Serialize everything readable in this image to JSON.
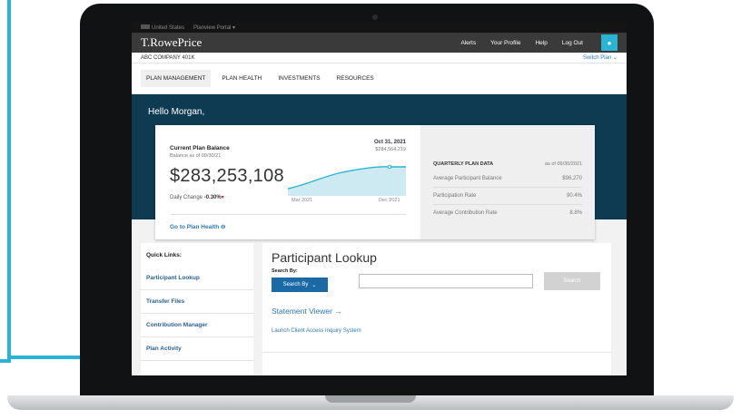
{
  "utility": {
    "country": "United States",
    "portal": "Planview Portal"
  },
  "topnav": {
    "logo": "T.RowePrice",
    "links": [
      "Alerts",
      "Your Profile",
      "Help",
      "Log Out"
    ]
  },
  "planbar": {
    "company": "ABC COMPANY 401K",
    "switch_label": "Switch Plan"
  },
  "mainnav": {
    "items": [
      "PLAN MANAGEMENT",
      "PLAN HEALTH",
      "INVESTMENTS",
      "RESOURCES"
    ]
  },
  "greeting": "Hello Morgan,",
  "balance_card": {
    "title": "Current Plan Balance",
    "as_of": "Balance as of 09/30/21",
    "amount": "$283,253,108",
    "daily_label": "Daily Change",
    "daily_value": "-0.30%",
    "spark_date": "Oct 31, 2021",
    "spark_value": "$284,564,219",
    "spark_start": "Mar 2021",
    "spark_end": "Dec 2021",
    "goto_link": "Go to Plan Health"
  },
  "quarterly": {
    "title": "QUARTERLY PLAN DATA",
    "as_of": "as of 09/30/2021",
    "rows": [
      {
        "label": "Average Participant Balance",
        "value": "$96,270"
      },
      {
        "label": "Participation Rate",
        "value": "90.4%"
      },
      {
        "label": "Average Contribution Rate",
        "value": "8.8%"
      }
    ]
  },
  "sidebar": {
    "heading": "Quick Links:",
    "links": [
      "Participant Lookup",
      "Transfer Files",
      "Contribution Manager",
      "Plan Activity"
    ]
  },
  "lookup": {
    "title": "Participant Lookup",
    "search_by_label": "Search By:",
    "select_label": "Search By",
    "search_value": "",
    "search_button": "Search",
    "statement_viewer": "Statement Viewer",
    "launch_link": "Launch Client Access Inquiry System"
  },
  "colors": {
    "accent": "#2bb3d6",
    "hero": "#0e3b52",
    "link": "#2b78b8",
    "button": "#1b6aa6"
  }
}
